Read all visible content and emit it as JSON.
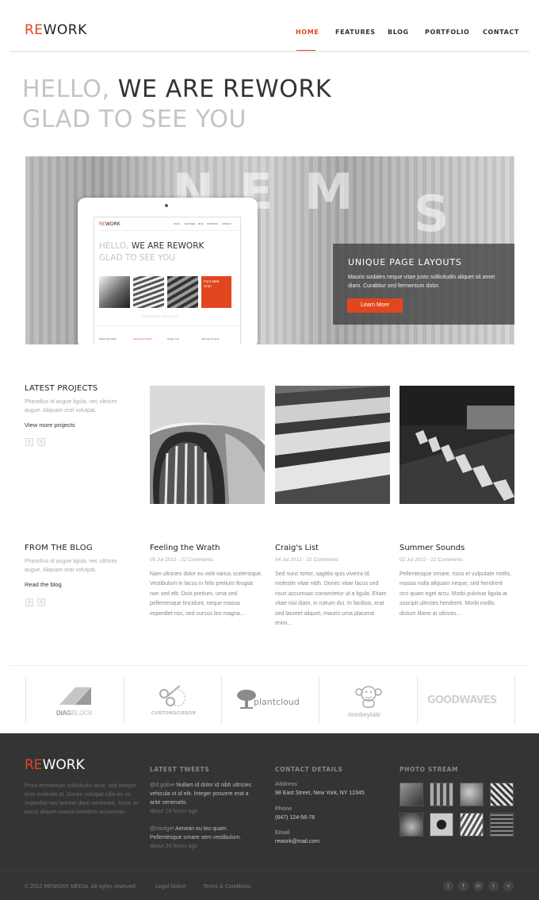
{
  "header": {
    "logo": {
      "re": "RE",
      "work": "WORK"
    },
    "nav": [
      "HOME",
      "FEATURES",
      "BLOG",
      "PORTFOLIO",
      "CONTACT"
    ],
    "active_nav": "HOME",
    "accent_color": "#e2461f"
  },
  "hero": {
    "line1_light": "HELLO,",
    "line1_dark": "WE ARE REWORK",
    "line2": "GLAD TO SEE YOU"
  },
  "banner": {
    "background_letters": [
      "N",
      "E",
      "M",
      "S"
    ],
    "tablet": {
      "logo": {
        "re": "RE",
        "work": "WORK"
      },
      "nav": [
        "HOME",
        "FEATURES",
        "BLOG",
        "PORTFOLIO",
        "CONTACT"
      ],
      "hero_light": "HELLO,",
      "hero_dark": "WE ARE REWORK",
      "hero_line2": "GLAD TO SEE YOU",
      "tile_label": "Font Web Cran",
      "view_more": "VIEW MORE PROJECTS",
      "footer_cols": [
        "Where We Work",
        "Feeling the Wrath",
        "Craig's List",
        "Summer Sounds"
      ]
    },
    "overlay_title": "UNIQUE PAGE LAYOUTS",
    "overlay_text": "Mauris sodales neque vitae justo sollicitudin aliquet sit amet diam. Curabitur sed fermentum dolor.",
    "overlay_button": "Learn More"
  },
  "latest_projects": {
    "title": "LATEST PROJECTS",
    "description": "Phasellus id augue ligula, nec ultrices augue. Aliquam erat volutpat.",
    "link": "View more projects",
    "prev_icon": "‹",
    "next_icon": "›",
    "projects": [
      "car-grille-photo",
      "stairs-photo",
      "seats-photo"
    ]
  },
  "blog": {
    "title": "FROM THE BLOG",
    "description": "Phasellus id augue ligula, nec ultrices augue. Aliquam erat volutpat.",
    "link": "Read the blog",
    "prev_icon": "‹",
    "next_icon": "›",
    "posts": [
      {
        "title": "Feeling the Wrath",
        "meta": "05 Jul 2012 - 22 Comments",
        "body": "Nam ultricies dolor eu velit varius scelerisque. Vestibulum in lacus in felis pretium feugiat non sed elit. Duis pretium, urna sed pellentesque tincidunt, neque massa imperdiet nisi, sed cursus leo magna..."
      },
      {
        "title": "Craig's List",
        "meta": "04 Jul 2012 - 22 Comments",
        "body": "Sed nunc tortor, sagittis quis viverra id, molestie vitae nibh. Donec vitae lacus sed risus accumsan consectetur ut a ligula. Etiam vitae nisi diam, in rutrum dui. In facilisis, erat sed laoreet aliquet, mauris urna placerat enim..."
      },
      {
        "title": "Summer Sounds",
        "meta": "02 Jul 2012 - 22 Comments",
        "body": "Pellentesque ornare, risus et vulputate mollis, massa nulla aliquam neque, sed hendrerit orci quam eget arcu. Morbi pulvinar ligula at suscipit ultricies hendrerit. Morbi mollis dictum libero at ultrices..."
      }
    ]
  },
  "clients": [
    {
      "name_a": "DIAG",
      "name_b": "BLOCK",
      "icon": "diagblock-logo"
    },
    {
      "name": "CUSTOMSCISSOR",
      "icon": "scissor-logo"
    },
    {
      "name": "plantcloud",
      "icon": "tree-logo"
    },
    {
      "name": "monkeytale",
      "icon": "monkey-logo"
    },
    {
      "name": "GOODWAVES",
      "icon": "goodwaves-logo"
    }
  ],
  "footer": {
    "logo": {
      "re": "RE",
      "work": "WORK"
    },
    "about": "Proin fermentum sollicitudin ante, sed tempor eros molestie id. Donec volutpat odio eu mi imperdiet nec laoreet diam venenatis. Nunc ac purus aliquet mauris interdum accumsan.",
    "tweets_title": "LATEST TWEETS",
    "tweets": [
      {
        "handle": "@d.golive",
        "text": "Nullam id dolor id nibh ultricies vehicula ut id elit. Integer posuere erat a ante venenatis.",
        "ago": "about 18 hours ago"
      },
      {
        "handle": "@modget",
        "text": "Aenean eu leo quam. Pellentesque ornare sem vestibulum.",
        "ago": "about 24 hours ago"
      }
    ],
    "contact_title": "CONTACT DETAILS",
    "contact": {
      "address_label": "Address",
      "address": "98 East Street, New York, NY 12345",
      "phone_label": "Phone",
      "phone": "(647) 124-56-78",
      "email_label": "Email",
      "email": "rework@mail.com"
    },
    "photo_title": "PHOTO STREAM",
    "copyright": "© 2012 REWORK MEDIA. All rights reserved",
    "legal": "Legal Notice",
    "terms": "Terms & Conditions",
    "social": [
      {
        "icon": "twitter-icon",
        "glyph": "t"
      },
      {
        "icon": "facebook-icon",
        "glyph": "f"
      },
      {
        "icon": "linkedin-icon",
        "glyph": "in"
      },
      {
        "icon": "tumblr-icon",
        "glyph": "t"
      },
      {
        "icon": "vimeo-icon",
        "glyph": "v"
      }
    ]
  }
}
